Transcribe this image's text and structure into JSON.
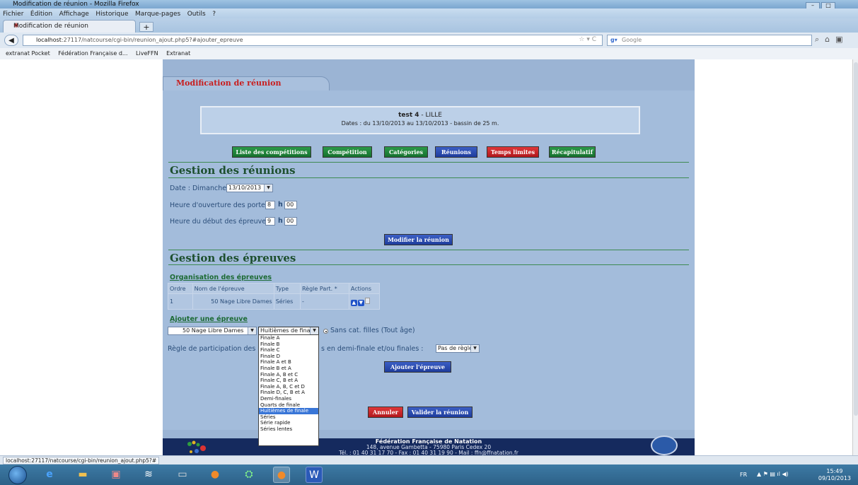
{
  "browser": {
    "window_title": "Modification de réunion - Mozilla Firefox",
    "menu": [
      "Fichier",
      "Édition",
      "Affichage",
      "Historique",
      "Marque-pages",
      "Outils",
      "?"
    ],
    "tab_title": "Modification de réunion",
    "new_tab": "+",
    "url_host": "localhost",
    "url_rest": ":27117/natcourse/cgi-bin/reunion_ajout.php5?#ajouter_epreuve",
    "search_placeholder": "Google",
    "bookmarks": [
      "extranat Pocket",
      "Fédération Française d...",
      "LiveFFN",
      "Extranat"
    ],
    "status_url": "localhost:27117/natcourse/cgi-bin/reunion_ajout.php5?#"
  },
  "page": {
    "header_tab": "Modification de réunion",
    "meeting": {
      "name": "test 4",
      "city": "LILLE",
      "dates_line": "Dates : du 13/10/2013 au 13/10/2013 - bassin de 25 m."
    },
    "nav_buttons": [
      {
        "label": "Liste des compétitions",
        "color": "#1f7f38"
      },
      {
        "label": "Compétition",
        "color": "#1f7f38"
      },
      {
        "label": "Catégories",
        "color": "#1f7f38"
      },
      {
        "label": "Réunions",
        "color": "#2a49b0"
      },
      {
        "label": "Temps limites",
        "color": "#c82327"
      },
      {
        "label": "Récapitulatif",
        "color": "#1f7f38"
      }
    ],
    "gestion_reunions": {
      "title": "Gestion des réunions",
      "date_label": "Date : Dimanche",
      "date_value": "13/10/2013",
      "ouverture_label": "Heure d'ouverture des portes :",
      "ouverture_h": "8",
      "ouverture_m": "00",
      "debut_label": "Heure du début des épreuves :",
      "debut_h": "9",
      "debut_m": "00",
      "h_sep": "h",
      "modifier_button": "Modifier la réunion"
    },
    "gestion_epreuves": {
      "title": "Gestion des épreuves",
      "organisation_title": "Organisation des épreuves",
      "table_headers": [
        "Ordre",
        "Nom de l'épreuve",
        "Type",
        "Règle Part. *",
        "Actions"
      ],
      "rows": [
        {
          "ordre": "1",
          "nom": "50 Nage Libre Dames",
          "type": "Séries",
          "regle": "-"
        }
      ],
      "ajouter_title": "Ajouter une épreuve",
      "epreuve_select": "50 Nage Libre Dames",
      "type_select": "Huitièmes de finale",
      "categorie_label": "Sans cat. filles (Tout âge)",
      "regle_label_a": "Règle de participation des",
      "regle_label_b": "s en demi-finale et/ou finales :",
      "regle_select": "Pas de règle",
      "ajouter_button": "Ajouter l'épreuve",
      "type_options": [
        "Finale A",
        "Finale B",
        "Finale C",
        "Finale D",
        "Finale A et B",
        "Finale B et A",
        "Finale A, B et C",
        "Finale C, B et A",
        "Finale A, B, C et D",
        "Finale D, C, B et A",
        "Demi-finales",
        "Quarts de finale",
        "Huitièmes de finale",
        "Séries",
        "Série rapide",
        "Séries lentes"
      ],
      "selected_option_index": 12
    },
    "annuler_button": "Annuler",
    "valider_button": "Valider la réunion",
    "footer": {
      "org": "Fédération Française de Natation",
      "address": "148, avenue Gambetta - 75980 Paris Cedex 20",
      "contact": "Tél. : 01 40 31 17 70 - Fax : 01 40 31 19 90 - Mail : ffn@ffnatation.fr"
    }
  },
  "taskbar": {
    "lang": "FR",
    "time": "15:49",
    "date": "09/10/2013"
  },
  "colors": {
    "panel": "#a3bcdb",
    "section_title": "#1d4f2e",
    "header_red": "#c81e1e",
    "footer": "#152a5e"
  }
}
